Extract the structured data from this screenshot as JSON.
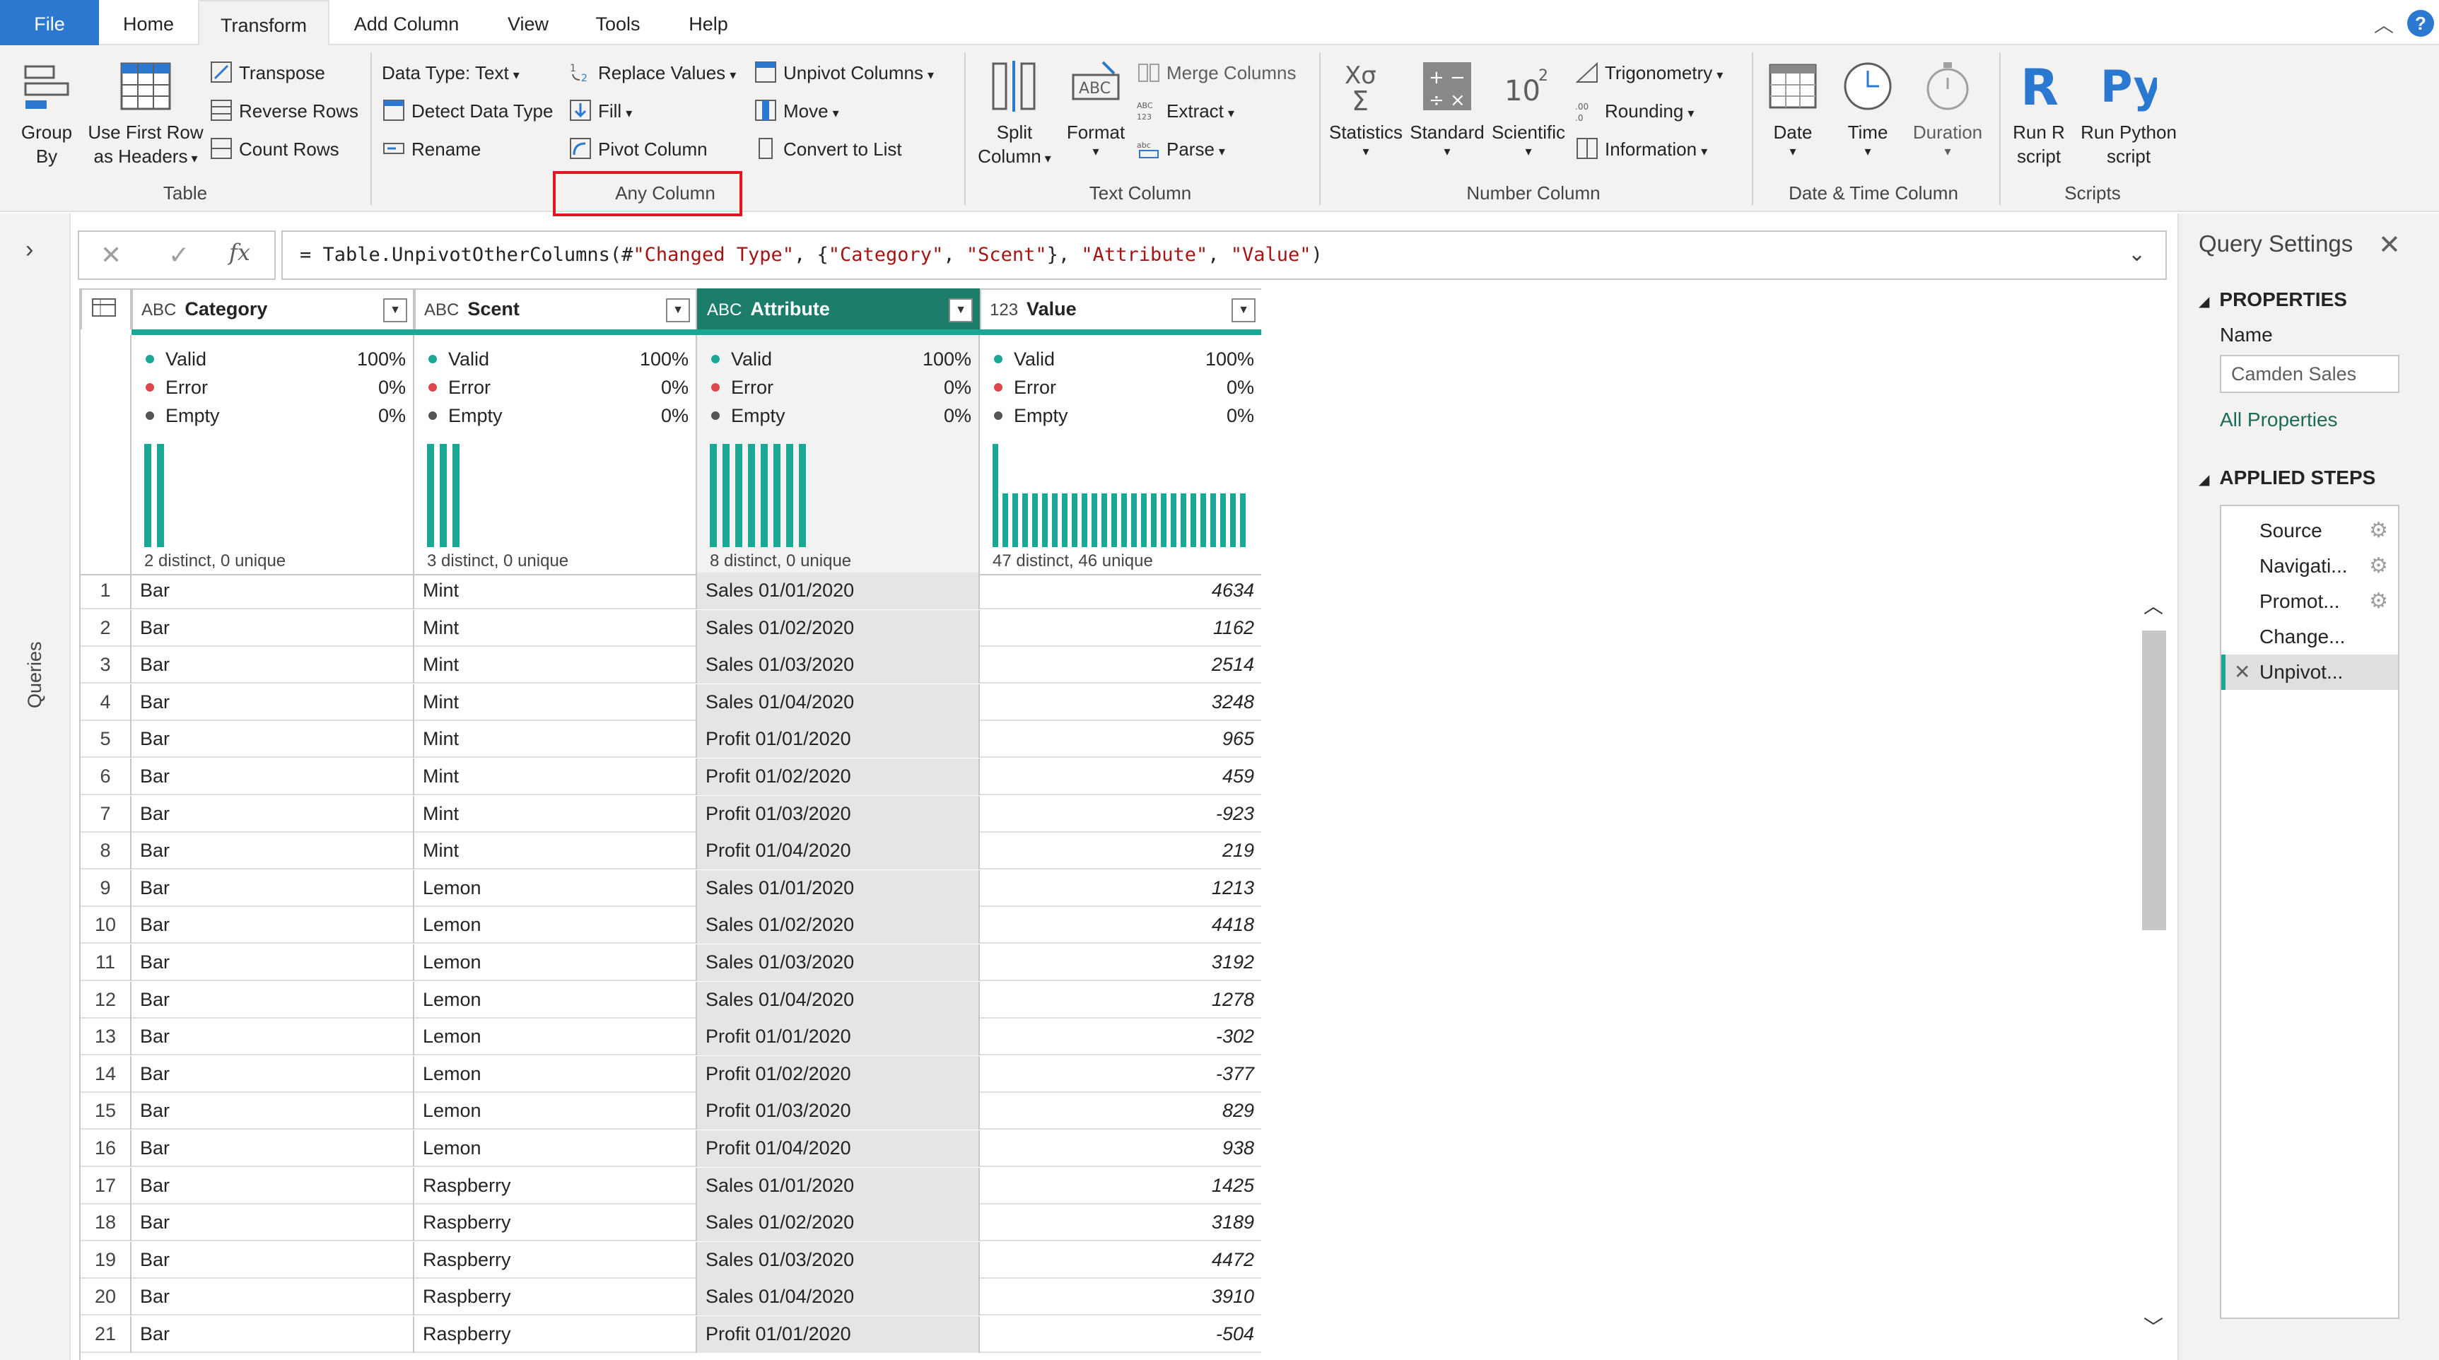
{
  "menu": {
    "tabs": [
      {
        "label": "File"
      },
      {
        "label": "Home"
      },
      {
        "label": "Transform"
      },
      {
        "label": "Add Column"
      },
      {
        "label": "View"
      },
      {
        "label": "Tools"
      },
      {
        "label": "Help"
      }
    ],
    "active_tab": "Transform",
    "help": "?"
  },
  "ribbon": {
    "table": {
      "label": "Table",
      "group_by": "Group\nBy",
      "use_first_row": "Use First Row\nas Headers",
      "transpose": "Transpose",
      "reverse_rows": "Reverse Rows",
      "count_rows": "Count Rows"
    },
    "any_column": {
      "label": "Any Column",
      "data_type": "Data Type: Text",
      "detect_data_type": "Detect Data Type",
      "rename": "Rename",
      "replace_values": "Replace Values",
      "fill": "Fill",
      "pivot_column": "Pivot Column",
      "unpivot_columns": "Unpivot Columns",
      "move": "Move",
      "convert_to_list": "Convert to List"
    },
    "text_column": {
      "label": "Text Column",
      "split_column": "Split\nColumn",
      "format": "Format",
      "merge_columns": "Merge Columns",
      "extract": "Extract",
      "parse": "Parse"
    },
    "number_column": {
      "label": "Number Column",
      "statistics": "Statistics",
      "standard": "Standard",
      "scientific": "Scientific",
      "trigonometry": "Trigonometry",
      "rounding": "Rounding",
      "information": "Information"
    },
    "datetime_column": {
      "label": "Date & Time Column",
      "date": "Date",
      "time": "Time",
      "duration": "Duration"
    },
    "scripts": {
      "label": "Scripts",
      "run_r": "Run R\nscript",
      "run_python": "Run Python\nscript"
    }
  },
  "queries_pane": {
    "label": "Queries"
  },
  "formula": {
    "prefix": "= Table.UnpivotOtherColumns(#",
    "s1": "\"Changed Type\"",
    "mid1": ", {",
    "s2": "\"Category\"",
    "mid2": ", ",
    "s3": "\"Scent\"",
    "mid3": "}, ",
    "s4": "\"Attribute\"",
    "mid4": ", ",
    "s5": "\"Value\"",
    "suffix": ")"
  },
  "columns": [
    {
      "name": "Category",
      "type": "ABC",
      "valid": "100%",
      "error": "0%",
      "empty": "0%",
      "distinct": "2 distinct, 0 unique"
    },
    {
      "name": "Scent",
      "type": "ABC",
      "valid": "100%",
      "error": "0%",
      "empty": "0%",
      "distinct": "3 distinct, 0 unique"
    },
    {
      "name": "Attribute",
      "type": "ABC",
      "valid": "100%",
      "error": "0%",
      "empty": "0%",
      "distinct": "8 distinct, 0 unique"
    },
    {
      "name": "Value",
      "type": "123",
      "valid": "100%",
      "error": "0%",
      "empty": "0%",
      "distinct": "47 distinct, 46 unique"
    }
  ],
  "profile_labels": {
    "valid": "Valid",
    "error": "Error",
    "empty": "Empty"
  },
  "rows": [
    {
      "idx": "1",
      "category": "Bar",
      "scent": "Mint",
      "attribute": "Sales 01/01/2020",
      "value": "4634"
    },
    {
      "idx": "2",
      "category": "Bar",
      "scent": "Mint",
      "attribute": "Sales 01/02/2020",
      "value": "1162"
    },
    {
      "idx": "3",
      "category": "Bar",
      "scent": "Mint",
      "attribute": "Sales 01/03/2020",
      "value": "2514"
    },
    {
      "idx": "4",
      "category": "Bar",
      "scent": "Mint",
      "attribute": "Sales 01/04/2020",
      "value": "3248"
    },
    {
      "idx": "5",
      "category": "Bar",
      "scent": "Mint",
      "attribute": "Profit 01/01/2020",
      "value": "965"
    },
    {
      "idx": "6",
      "category": "Bar",
      "scent": "Mint",
      "attribute": "Profit 01/02/2020",
      "value": "459"
    },
    {
      "idx": "7",
      "category": "Bar",
      "scent": "Mint",
      "attribute": "Profit 01/03/2020",
      "value": "-923"
    },
    {
      "idx": "8",
      "category": "Bar",
      "scent": "Mint",
      "attribute": "Profit 01/04/2020",
      "value": "219"
    },
    {
      "idx": "9",
      "category": "Bar",
      "scent": "Lemon",
      "attribute": "Sales 01/01/2020",
      "value": "1213"
    },
    {
      "idx": "10",
      "category": "Bar",
      "scent": "Lemon",
      "attribute": "Sales 01/02/2020",
      "value": "4418"
    },
    {
      "idx": "11",
      "category": "Bar",
      "scent": "Lemon",
      "attribute": "Sales 01/03/2020",
      "value": "3192"
    },
    {
      "idx": "12",
      "category": "Bar",
      "scent": "Lemon",
      "attribute": "Sales 01/04/2020",
      "value": "1278"
    },
    {
      "idx": "13",
      "category": "Bar",
      "scent": "Lemon",
      "attribute": "Profit 01/01/2020",
      "value": "-302"
    },
    {
      "idx": "14",
      "category": "Bar",
      "scent": "Lemon",
      "attribute": "Profit 01/02/2020",
      "value": "-377"
    },
    {
      "idx": "15",
      "category": "Bar",
      "scent": "Lemon",
      "attribute": "Profit 01/03/2020",
      "value": "829"
    },
    {
      "idx": "16",
      "category": "Bar",
      "scent": "Lemon",
      "attribute": "Profit 01/04/2020",
      "value": "938"
    },
    {
      "idx": "17",
      "category": "Bar",
      "scent": "Raspberry",
      "attribute": "Sales 01/01/2020",
      "value": "1425"
    },
    {
      "idx": "18",
      "category": "Bar",
      "scent": "Raspberry",
      "attribute": "Sales 01/02/2020",
      "value": "3189"
    },
    {
      "idx": "19",
      "category": "Bar",
      "scent": "Raspberry",
      "attribute": "Sales 01/03/2020",
      "value": "4472"
    },
    {
      "idx": "20",
      "category": "Bar",
      "scent": "Raspberry",
      "attribute": "Sales 01/04/2020",
      "value": "3910"
    },
    {
      "idx": "21",
      "category": "Bar",
      "scent": "Raspberry",
      "attribute": "Profit 01/01/2020",
      "value": "-504"
    }
  ],
  "query_settings": {
    "title": "Query Settings",
    "properties_label": "PROPERTIES",
    "name_label": "Name",
    "name_value": "Camden Sales",
    "all_properties": "All Properties",
    "applied_steps_label": "APPLIED STEPS",
    "steps": [
      {
        "label": "Source"
      },
      {
        "label": "Navigati..."
      },
      {
        "label": "Promot..."
      },
      {
        "label": "Change..."
      },
      {
        "label": "Unpivot..."
      }
    ]
  },
  "colors": {
    "accent": "#1aa894",
    "selected_header": "#1c7e6a",
    "file_tab": "#2b78d0",
    "highlight": "#e3131f",
    "valid_dot": "#1aa894",
    "error_dot": "#e0474c",
    "empty_dot": "#555555"
  }
}
